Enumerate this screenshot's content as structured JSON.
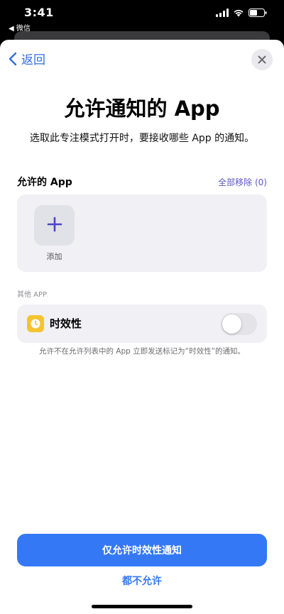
{
  "status_bar": {
    "time": "3:41",
    "back_app": "◀ 微信"
  },
  "nav": {
    "back_label": "返回",
    "close_icon": "close-icon"
  },
  "header": {
    "title": "允许通知的 App",
    "subtitle": "选取此专注模式打开时，要接收哪些 App 的通知。"
  },
  "allowed_apps": {
    "section_title": "允许的 App",
    "remove_all": "全部移除 (0)",
    "add_label": "添加"
  },
  "other_apps": {
    "section_label": "其他 APP",
    "timely_label": "时效性",
    "timely_enabled": false,
    "footnote": "允许不在允许列表中的 App 立即发送标记为“时效性”的通知。"
  },
  "actions": {
    "primary_label": "仅允许时效性通知",
    "secondary_label": "都不允许"
  },
  "colors": {
    "accent": "#3478f6",
    "remove_all": "#5a55c4",
    "timely_icon": "#f4c430",
    "card_bg": "#f0f0f5"
  }
}
